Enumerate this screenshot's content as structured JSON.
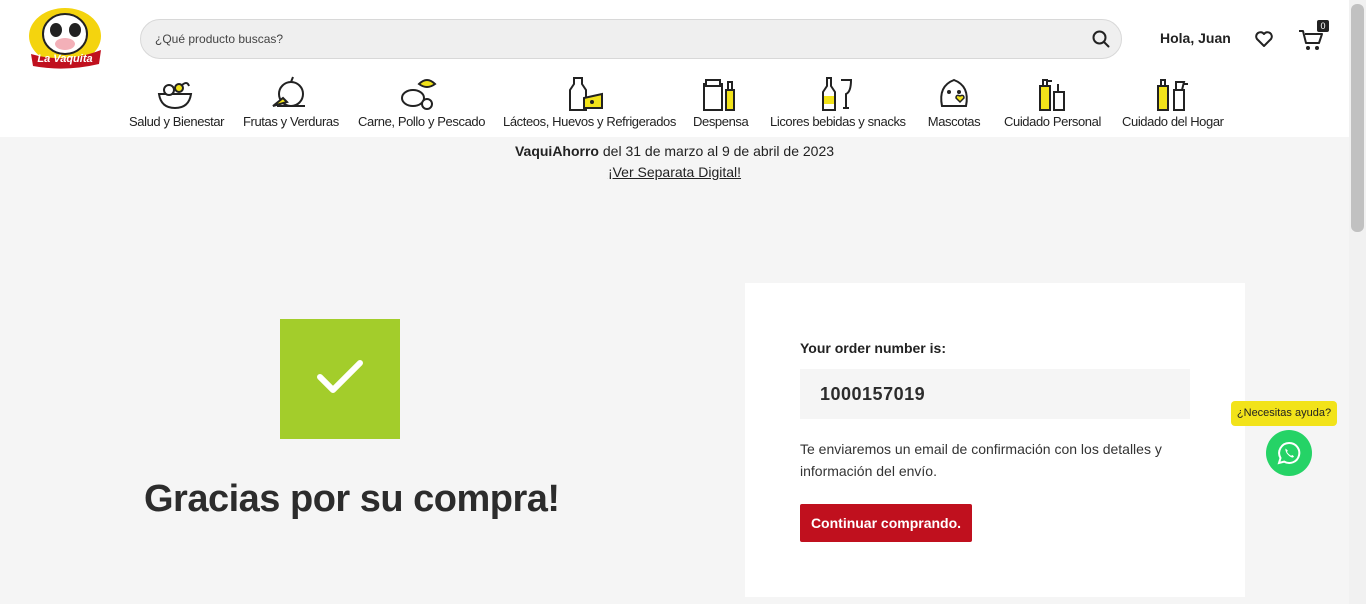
{
  "header": {
    "logo_text": "La Vaquita",
    "search_placeholder": "¿Qué producto buscas?",
    "greeting": "Hola, Juan",
    "cart_count": "0"
  },
  "categories": [
    {
      "label": "Salud y Bienestar",
      "icon": "salad-bowl-icon"
    },
    {
      "label": "Frutas y Verduras",
      "icon": "fruits-icon"
    },
    {
      "label": "Carne, Pollo y Pescado",
      "icon": "meat-fish-icon"
    },
    {
      "label": "Lácteos, Huevos y Refrigerados",
      "icon": "milk-cheese-icon"
    },
    {
      "label": "Despensa",
      "icon": "pantry-icon"
    },
    {
      "label": "Licores bebidas y snacks",
      "icon": "bottle-glass-icon"
    },
    {
      "label": "Mascotas",
      "icon": "pet-icon"
    },
    {
      "label": "Cuidado Personal",
      "icon": "personal-care-icon"
    },
    {
      "label": "Cuidado del Hogar",
      "icon": "home-care-icon"
    }
  ],
  "promo": {
    "brand": "VaquiAhorro",
    "dates": " del 31 de marzo al 9 de abril de 2023",
    "link": "¡Ver Separata Digital!"
  },
  "confirmation": {
    "title": "Gracias por su compra!",
    "order_label": "Your order number is:",
    "order_number": "1000157019",
    "message": "Te enviaremos un email de confirmación con los detalles y información del envío.",
    "continue_label": "Continuar comprando."
  },
  "help": {
    "bubble": "¿Necesitas ayuda?"
  },
  "colors": {
    "brand_red": "#c0101e",
    "success_green": "#a3cd2b",
    "whatsapp_green": "#25d366",
    "accent_yellow": "#f2e31a"
  }
}
